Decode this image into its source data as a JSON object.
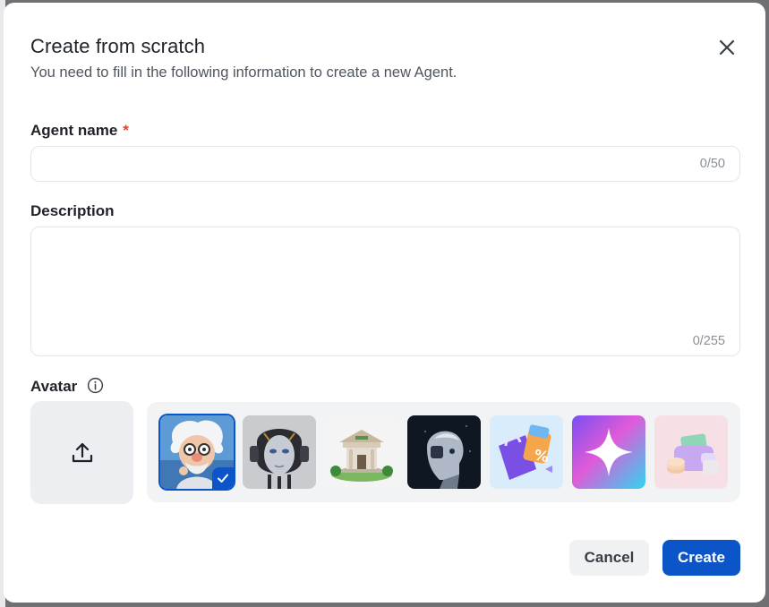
{
  "dialog": {
    "title": "Create from scratch",
    "subtitle": "You need to fill in the following information to create a new Agent."
  },
  "fields": {
    "agent_name": {
      "label": "Agent name",
      "required_mark": "*",
      "value": "",
      "counter": "0/50"
    },
    "description": {
      "label": "Description",
      "value": "",
      "counter": "0/255"
    }
  },
  "avatar": {
    "label": "Avatar",
    "info_icon": "info-circle-icon",
    "upload_icon": "upload-icon",
    "options": [
      {
        "name": "scientist-avatar",
        "selected": true
      },
      {
        "name": "robot-face-avatar",
        "selected": false
      },
      {
        "name": "bank-building-avatar",
        "selected": false
      },
      {
        "name": "robot-profile-avatar",
        "selected": false
      },
      {
        "name": "shopping-bag-avatar",
        "selected": false
      },
      {
        "name": "sparkle-star-avatar",
        "selected": false
      },
      {
        "name": "wallet-coins-avatar",
        "selected": false
      }
    ]
  },
  "actions": {
    "cancel_label": "Cancel",
    "create_label": "Create"
  },
  "colors": {
    "accent": "#0b55c9",
    "required": "#e0442f"
  }
}
